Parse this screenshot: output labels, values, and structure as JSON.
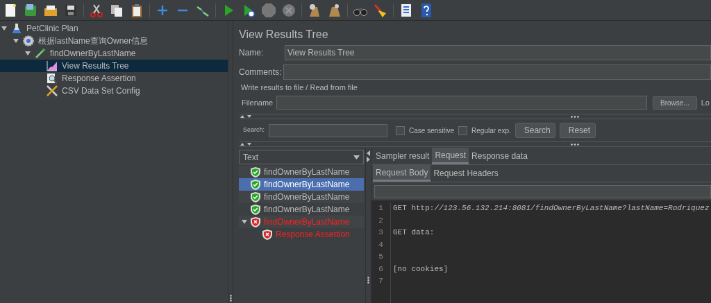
{
  "test_tree": [
    {
      "label": "PetClinic Plan",
      "kind": "plan",
      "expanded": true,
      "selected": false,
      "children": [
        {
          "label": "根据lastName查询Owner信息",
          "kind": "thread-group",
          "expanded": true,
          "selected": false,
          "children": [
            {
              "label": "findOwnerByLastName",
              "kind": "sampler",
              "expanded": true,
              "selected": false,
              "children": [
                {
                  "label": "View Results Tree",
                  "kind": "listener",
                  "selected": true
                },
                {
                  "label": "Response Assertion",
                  "kind": "assertion",
                  "selected": false
                },
                {
                  "label": "CSV Data Set Config",
                  "kind": "config",
                  "selected": false
                }
              ]
            }
          ]
        }
      ]
    }
  ],
  "panel": {
    "title": "View Results Tree",
    "name_label": "Name:",
    "name_value": "View Results Tree",
    "comments_label": "Comments:",
    "file_group": "Write results to file / Read from file",
    "filename_label": "Filename",
    "browse_button": "Browse...",
    "log_label": "Lo",
    "search_label": "Search:",
    "case_sensitive": {
      "label": "Case sensitive",
      "checked": false
    },
    "regular_exp": {
      "label": "Regular exp.",
      "checked": false
    },
    "search_button": "Search",
    "reset_button": "Reset"
  },
  "renderer": {
    "value": "Text"
  },
  "results": [
    {
      "label": "findOwnerByLastName",
      "passed": true,
      "selected": false
    },
    {
      "label": "findOwnerByLastName",
      "passed": true,
      "selected": true
    },
    {
      "label": "findOwnerByLastName",
      "passed": true,
      "selected": false
    },
    {
      "label": "findOwnerByLastName",
      "passed": true,
      "selected": false
    },
    {
      "label": "findOwnerByLastName",
      "passed": false,
      "selected": false,
      "expanded": true,
      "children": [
        {
          "label": "Response Assertion",
          "passed": false,
          "selected": false
        }
      ]
    }
  ],
  "tabs": [
    {
      "label": "Sampler result",
      "selected": false
    },
    {
      "label": "Request",
      "selected": true
    },
    {
      "label": "Response data",
      "selected": false
    }
  ],
  "subtabs": [
    {
      "label": "Request Body",
      "selected": true
    },
    {
      "label": "Request Headers",
      "selected": false
    }
  ],
  "code_lines": [
    {
      "number": "1",
      "text": "GET http:*//123.56.132.214:8081/findOwnerByLastName?lastName=Rodriquez*"
    },
    {
      "number": "2"
    },
    {
      "number": "3",
      "text": "GET data:"
    },
    {
      "number": "4"
    },
    {
      "number": "5"
    },
    {
      "number": "6",
      "text": "[no cookies]"
    },
    {
      "number": "7"
    }
  ]
}
